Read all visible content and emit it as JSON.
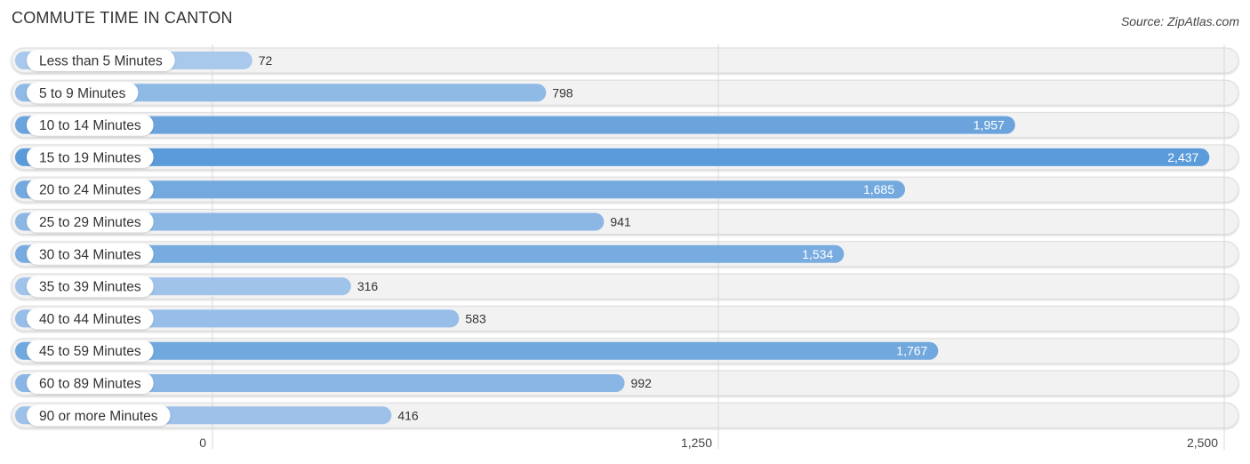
{
  "header": {
    "title": "COMMUTE TIME IN CANTON",
    "source": "Source: ZipAtlas.com"
  },
  "chart_data": {
    "type": "bar",
    "orientation": "horizontal",
    "title": "COMMUTE TIME IN CANTON",
    "xlabel": "",
    "ylabel": "",
    "xlim": [
      0,
      2500
    ],
    "x_ticks": [
      0,
      1250,
      2500
    ],
    "x_tick_labels": [
      "0",
      "1,250",
      "2,500"
    ],
    "grid": true,
    "categories": [
      "Less than 5 Minutes",
      "5 to 9 Minutes",
      "10 to 14 Minutes",
      "15 to 19 Minutes",
      "20 to 24 Minutes",
      "25 to 29 Minutes",
      "30 to 34 Minutes",
      "35 to 39 Minutes",
      "40 to 44 Minutes",
      "45 to 59 Minutes",
      "60 to 89 Minutes",
      "90 or more Minutes"
    ],
    "values": [
      72,
      798,
      1957,
      2437,
      1685,
      941,
      1534,
      316,
      583,
      1767,
      992,
      416
    ],
    "value_labels": [
      "72",
      "798",
      "1,957",
      "2,437",
      "1,685",
      "941",
      "1,534",
      "316",
      "583",
      "1,767",
      "992",
      "416"
    ],
    "colors": {
      "bar_max": "#5b9bd9",
      "bar_min": "#a8c8ec",
      "track": "#f2f2f2",
      "track_border": "#dcdcdc",
      "grid": "#d8d8d8"
    }
  }
}
